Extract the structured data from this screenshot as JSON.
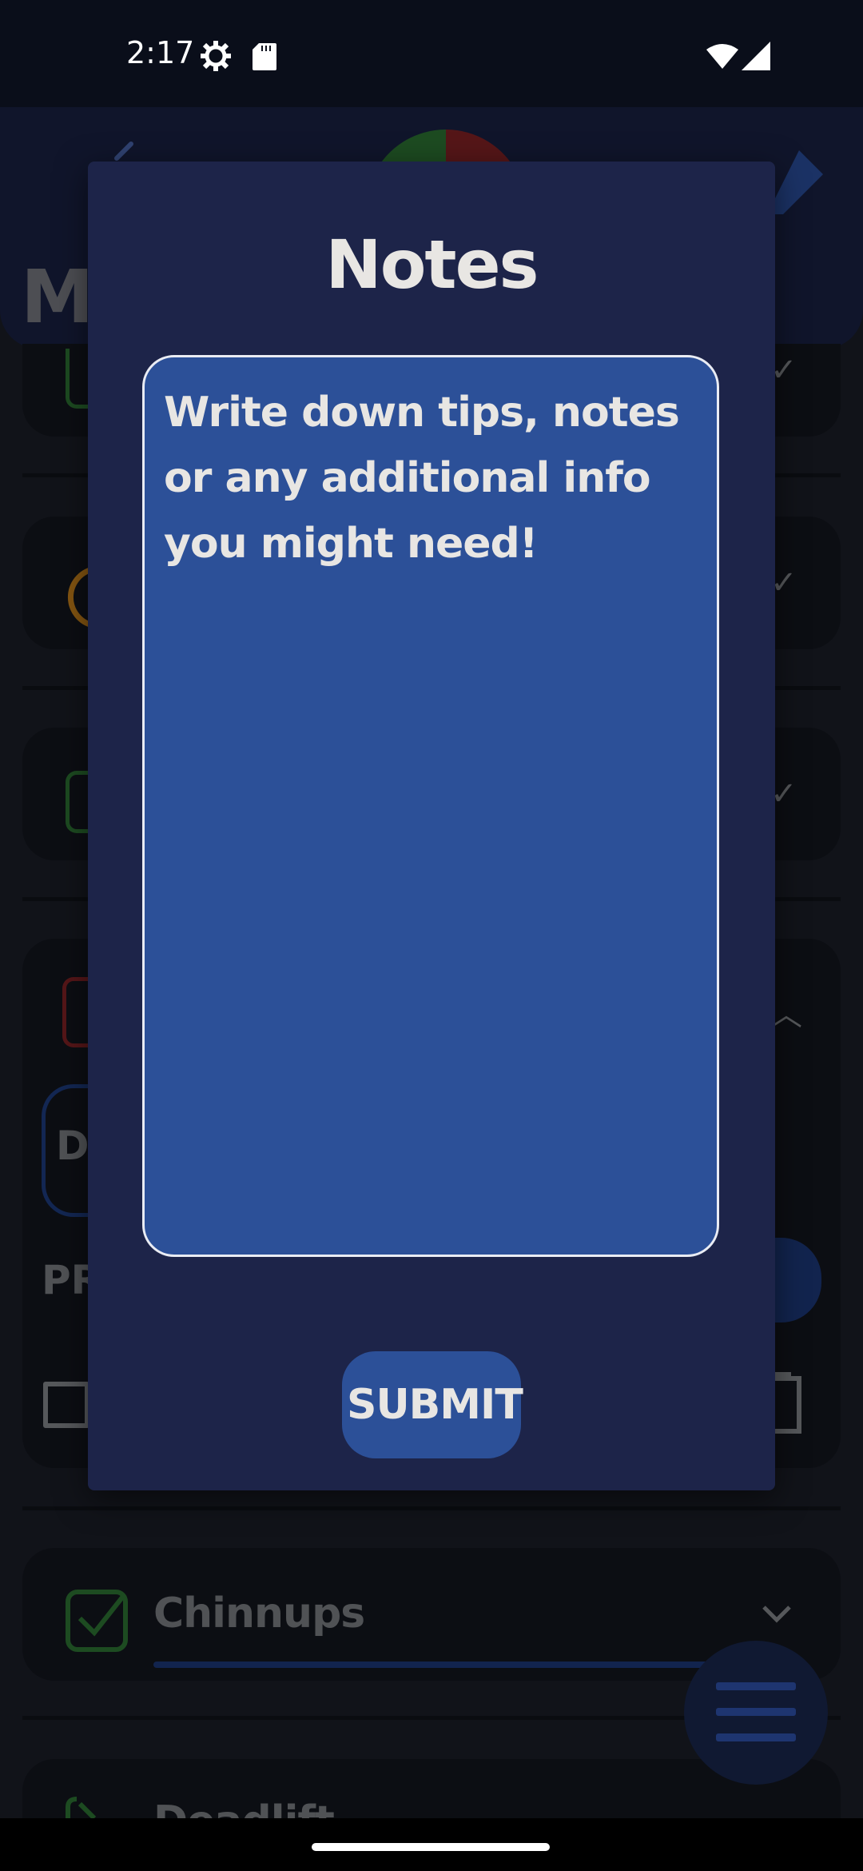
{
  "status_bar": {
    "time": "2:17",
    "icons": [
      "settings-icon",
      "sd-card-icon",
      "wifi-icon",
      "signal-icon"
    ]
  },
  "header": {
    "title_partial": "Mo"
  },
  "background_list": {
    "section_label_partial": "PR",
    "chip_label_partial": "Dr",
    "items": [
      {
        "name": "Chinnups",
        "status": "done"
      },
      {
        "name": "Deadlift",
        "status": "done"
      }
    ]
  },
  "dialog": {
    "title": "Notes",
    "notes_placeholder": "Write down tips, notes or any additional info you might need!",
    "submit_label": "SUBMIT"
  },
  "colors": {
    "dialog_bg": "#1d2449",
    "field_bg": "#2c5098",
    "check_green": "#2f7a36",
    "status_bar_bg": "#0a0e1a"
  }
}
